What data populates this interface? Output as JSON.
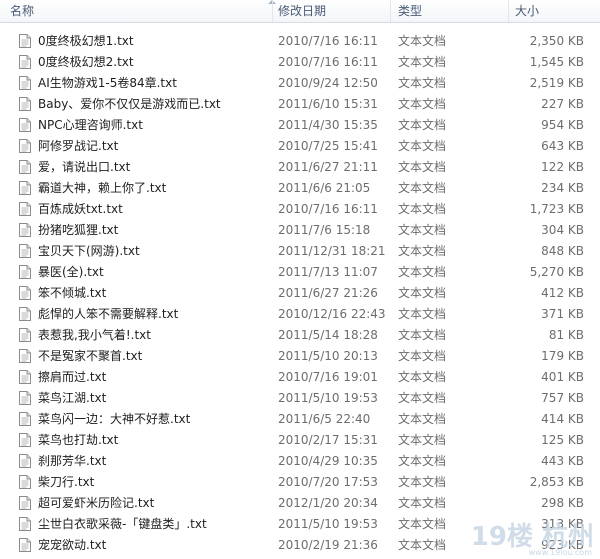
{
  "columns": {
    "name": "名称",
    "date": "修改日期",
    "type": "类型",
    "size": "大小"
  },
  "files": [
    {
      "name": "0度终极幻想1.txt",
      "date": "2010/7/16 16:11",
      "type": "文本文档",
      "size": "2,350 KB"
    },
    {
      "name": "0度终极幻想2.txt",
      "date": "2010/7/16 16:11",
      "type": "文本文档",
      "size": "1,545 KB"
    },
    {
      "name": "AI生物游戏1-5卷84章.txt",
      "date": "2010/9/24 12:50",
      "type": "文本文档",
      "size": "2,519 KB"
    },
    {
      "name": "Baby、爱你不仅仅是游戏而已.txt",
      "date": "2011/6/10 15:31",
      "type": "文本文档",
      "size": "227 KB"
    },
    {
      "name": "NPC心理咨询师.txt",
      "date": "2011/4/30 15:35",
      "type": "文本文档",
      "size": "954 KB"
    },
    {
      "name": "阿修罗战记.txt",
      "date": "2010/7/25 15:41",
      "type": "文本文档",
      "size": "643 KB"
    },
    {
      "name": "爱，请说出口.txt",
      "date": "2011/6/27 21:11",
      "type": "文本文档",
      "size": "122 KB"
    },
    {
      "name": "霸道大神，赖上你了.txt",
      "date": "2011/6/6 21:05",
      "type": "文本文档",
      "size": "234 KB"
    },
    {
      "name": "百炼成妖txt.txt",
      "date": "2010/7/16 16:11",
      "type": "文本文档",
      "size": "1,723 KB"
    },
    {
      "name": "扮猪吃狐狸.txt",
      "date": "2011/7/6 15:18",
      "type": "文本文档",
      "size": "304 KB"
    },
    {
      "name": "宝贝天下(网游).txt",
      "date": "2011/12/31 18:21",
      "type": "文本文档",
      "size": "848 KB"
    },
    {
      "name": "暴医(全).txt",
      "date": "2011/7/13 11:07",
      "type": "文本文档",
      "size": "5,270 KB"
    },
    {
      "name": "笨不倾城.txt",
      "date": "2011/6/27 21:26",
      "type": "文本文档",
      "size": "412 KB"
    },
    {
      "name": "彪悍的人笨不需要解释.txt",
      "date": "2010/12/16 22:43",
      "type": "文本文档",
      "size": "371 KB"
    },
    {
      "name": "表惹我,我小气着!.txt",
      "date": "2011/5/14 18:28",
      "type": "文本文档",
      "size": "81 KB"
    },
    {
      "name": "不是冤家不聚首.txt",
      "date": "2011/5/10 20:13",
      "type": "文本文档",
      "size": "179 KB"
    },
    {
      "name": "擦肩而过.txt",
      "date": "2010/7/16 19:01",
      "type": "文本文档",
      "size": "401 KB"
    },
    {
      "name": "菜鸟江湖.txt",
      "date": "2011/5/10 19:53",
      "type": "文本文档",
      "size": "757 KB"
    },
    {
      "name": "菜鸟闪一边：大神不好惹.txt",
      "date": "2011/6/5 22:40",
      "type": "文本文档",
      "size": "414 KB"
    },
    {
      "name": "菜鸟也打劫.txt",
      "date": "2010/2/17 15:31",
      "type": "文本文档",
      "size": "125 KB"
    },
    {
      "name": "刹那芳华.txt",
      "date": "2010/4/29 10:35",
      "type": "文本文档",
      "size": "443 KB"
    },
    {
      "name": "柴刀行.txt",
      "date": "2010/7/20 17:53",
      "type": "文本文档",
      "size": "2,853 KB"
    },
    {
      "name": "超可爱虾米历险记.txt",
      "date": "2012/1/20 20:34",
      "type": "文本文档",
      "size": "298 KB"
    },
    {
      "name": "尘世白衣歌采薇-「键盘类」.txt",
      "date": "2011/5/10 19:53",
      "type": "文本文档",
      "size": "313 KB"
    },
    {
      "name": "宠宠欲动.txt",
      "date": "2010/2/19 21:36",
      "type": "文本文档",
      "size": "923 KB"
    }
  ],
  "watermark": {
    "main": "19楼 杭州",
    "sub": "www.19lou.com"
  }
}
